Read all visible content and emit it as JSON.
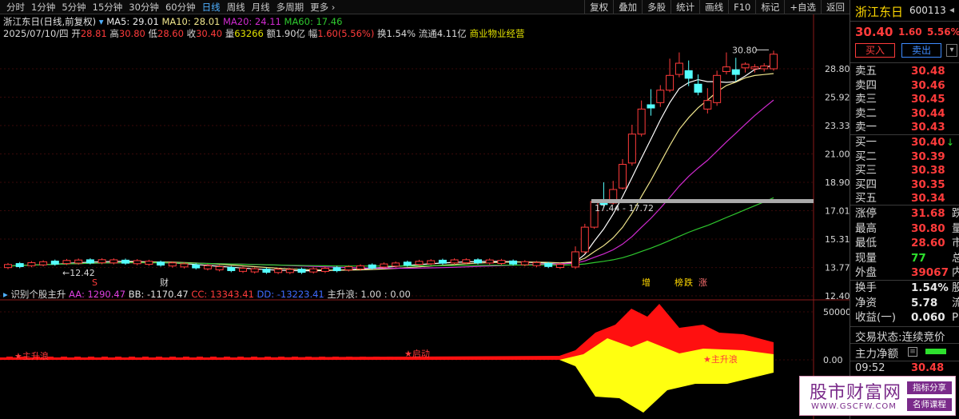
{
  "toolbar": {
    "periods": [
      "分时",
      "1分钟",
      "5分钟",
      "15分钟",
      "30分钟",
      "60分钟",
      "日线",
      "周线",
      "月线",
      "多周期",
      "更多"
    ],
    "active_period": "日线",
    "buttons": [
      "复权",
      "叠加",
      "多股",
      "统计",
      "画线",
      "F10",
      "标记",
      "+自选",
      "返回"
    ]
  },
  "info": {
    "line1": {
      "name": "浙江东日(日线,前复权)",
      "ma5": "MA5: 29.01",
      "ma10": "MA10: 28.01",
      "ma20": "MA20: 24.11",
      "ma60": "MA60: 17.46"
    },
    "line2": {
      "date": "2025/07/10/四",
      "open_label": "开",
      "open": "28.81",
      "high_label": "高",
      "high": "30.80",
      "low_label": "低",
      "low": "28.60",
      "close_label": "收",
      "close": "30.40",
      "vol_label": "量",
      "vol": "63266",
      "amt": "额1.90亿",
      "amp_label": "幅",
      "amp": "1.60(5.56%)",
      "turnover": "换1.54%",
      "float": "流通4.11亿",
      "industry": "商业物业经营"
    }
  },
  "chart_data": [
    {
      "type": "candlestick",
      "title": "浙江东日(日线,前复权)",
      "y_ticks": [
        "28.80",
        "25.92",
        "23.33",
        "21.00",
        "18.90",
        "17.01",
        "15.31",
        "13.77",
        "12.40"
      ],
      "annotations": [
        "30.80",
        "17.44 - 17.72",
        "←12.42",
        "S",
        "财",
        "增",
        "榜",
        "跌",
        "涨"
      ],
      "series": [
        {
          "name": "MA5",
          "last": 29.01,
          "color": "#ffffff"
        },
        {
          "name": "MA10",
          "last": 28.01,
          "color": "#f0e68c"
        },
        {
          "name": "MA20",
          "last": 24.11,
          "color": "#d02ad0"
        },
        {
          "name": "MA60",
          "last": 17.46,
          "color": "#2ec82e"
        }
      ],
      "candles_rally": [
        {
          "o": 13.8,
          "c": 14.6,
          "h": 14.9,
          "l": 13.7
        },
        {
          "o": 14.6,
          "c": 16.0,
          "h": 16.2,
          "l": 14.5
        },
        {
          "o": 16.0,
          "c": 17.6,
          "h": 17.7,
          "l": 15.9
        },
        {
          "o": 17.7,
          "c": 17.4,
          "h": 18.9,
          "l": 17.2
        },
        {
          "o": 17.5,
          "c": 18.4,
          "h": 19.0,
          "l": 17.4
        },
        {
          "o": 18.5,
          "c": 20.2,
          "h": 20.6,
          "l": 18.4
        },
        {
          "o": 20.3,
          "c": 22.6,
          "h": 23.4,
          "l": 20.1
        },
        {
          "o": 22.6,
          "c": 24.8,
          "h": 25.6,
          "l": 22.4
        },
        {
          "o": 25.2,
          "c": 24.9,
          "h": 26.7,
          "l": 24.2
        },
        {
          "o": 25.4,
          "c": 26.6,
          "h": 27.1,
          "l": 25.0
        },
        {
          "o": 26.6,
          "c": 28.1,
          "h": 29.9,
          "l": 26.4
        },
        {
          "o": 28.2,
          "c": 29.4,
          "h": 30.6,
          "l": 27.9
        },
        {
          "o": 28.6,
          "c": 27.8,
          "h": 29.7,
          "l": 27.0
        },
        {
          "o": 27.2,
          "c": 26.4,
          "h": 28.2,
          "l": 26.1
        },
        {
          "o": 24.8,
          "c": 25.6,
          "h": 26.8,
          "l": 24.4
        },
        {
          "o": 25.4,
          "c": 28.1,
          "h": 28.6,
          "l": 25.1
        },
        {
          "o": 28.5,
          "c": 29.0,
          "h": 30.6,
          "l": 28.2
        },
        {
          "o": 28.7,
          "c": 28.2,
          "h": 30.0,
          "l": 27.5
        },
        {
          "o": 28.9,
          "c": 29.3,
          "h": 29.5,
          "l": 28.4
        },
        {
          "o": 28.8,
          "c": 29.0,
          "h": 29.3,
          "l": 28.4
        },
        {
          "o": 28.8,
          "c": 29.1,
          "h": 29.4,
          "l": 28.5
        },
        {
          "o": 28.8,
          "c": 30.4,
          "h": 30.8,
          "l": 28.6
        }
      ]
    },
    {
      "type": "area",
      "title": "识别个股主升",
      "legend": [
        "AA: 1290.47",
        "BB: -1170.47",
        "CC: 13343.41",
        "DD: -13223.41",
        "主升浪: 1.00 : 0.00"
      ],
      "y_ticks": [
        "50000",
        "0.00"
      ],
      "labels": [
        "主升浪",
        "启动",
        "主升浪"
      ]
    }
  ],
  "panel": {
    "name": "浙江东日",
    "code": "600113",
    "price": "30.40",
    "change": "1.60",
    "pct": "5.56%",
    "buy_btn": "买入",
    "sell_btn": "卖出",
    "asks": [
      {
        "label": "卖五",
        "price": "30.48"
      },
      {
        "label": "卖四",
        "price": "30.46"
      },
      {
        "label": "卖三",
        "price": "30.45"
      },
      {
        "label": "卖二",
        "price": "30.44"
      },
      {
        "label": "卖一",
        "price": "30.43"
      }
    ],
    "bids": [
      {
        "label": "买一",
        "price": "30.40"
      },
      {
        "label": "买二",
        "price": "30.39"
      },
      {
        "label": "买三",
        "price": "30.38"
      },
      {
        "label": "买四",
        "price": "30.35"
      },
      {
        "label": "买五",
        "price": "30.34"
      }
    ],
    "stats": [
      {
        "label": "涨停",
        "value": "31.68",
        "right": "跌"
      },
      {
        "label": "最高",
        "value": "30.80",
        "right": "量"
      },
      {
        "label": "最低",
        "value": "28.60",
        "right": "市"
      },
      {
        "label": "现量",
        "value": "77",
        "right": "总"
      },
      {
        "label": "外盘",
        "value": "39067",
        "right": "内"
      }
    ],
    "stats2": [
      {
        "label": "换手",
        "value": "1.54%",
        "right": "股"
      },
      {
        "label": "净资",
        "value": "5.78",
        "right": "流"
      },
      {
        "label": "收益(一)",
        "value": "0.060",
        "right": "PE"
      }
    ],
    "status_label": "交易状态:",
    "status_value": "连续竞价",
    "mainforce_label": "主力净额",
    "time": "09:52",
    "time_price": "30.48"
  },
  "watermark": {
    "text": "股市财富网",
    "url": "WWW.GSCFW.COM",
    "tag1": "指标分享",
    "tag2": "名师课程"
  }
}
